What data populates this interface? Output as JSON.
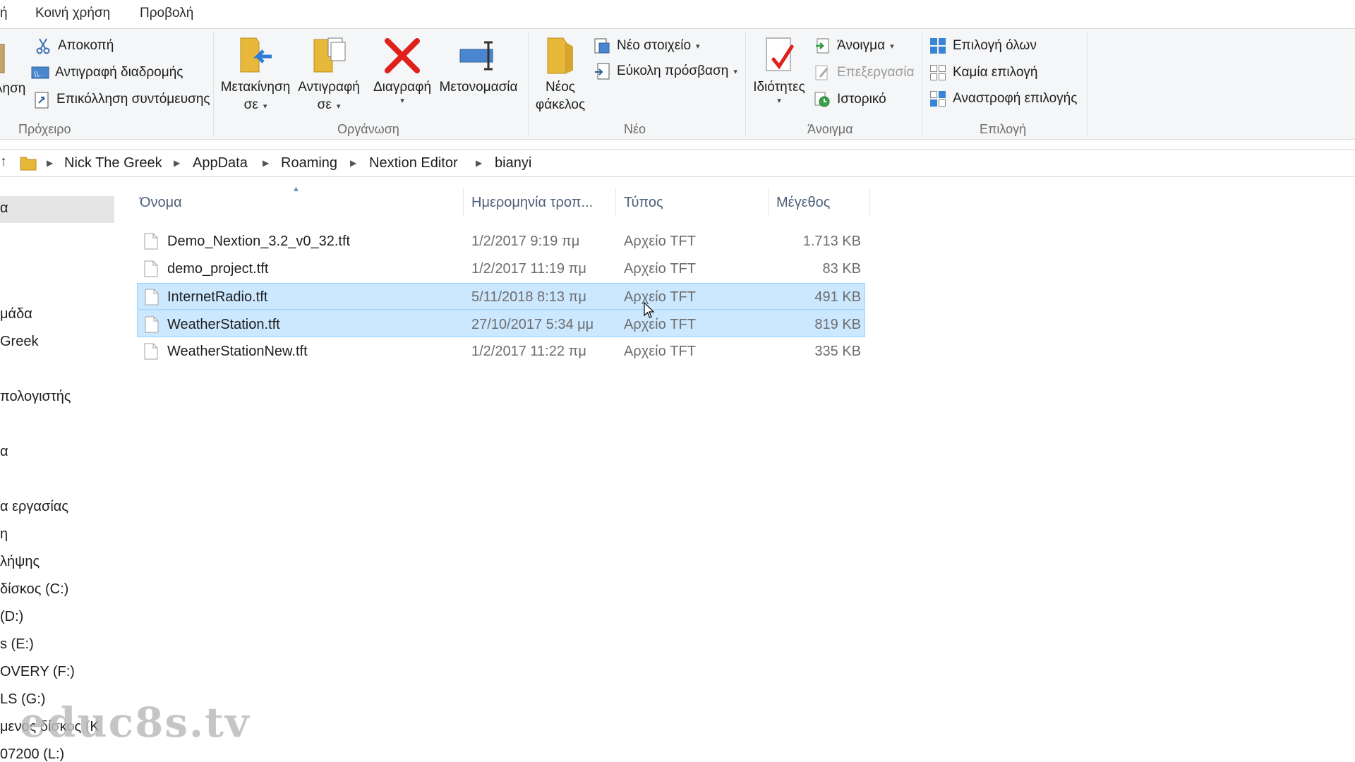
{
  "ribbon_tabs": [
    "ή",
    "Κοινή χρήση",
    "Προβολή"
  ],
  "clipboard": {
    "label": "Πρόχειρο",
    "paste_partial": "ληση",
    "cut": "Αποκοπή",
    "copy_path": "Αντιγραφή διαδρομής",
    "paste_shortcut": "Επικόλληση συντόμευσης"
  },
  "organize": {
    "label": "Οργάνωση",
    "move_to": [
      "Μετακίνηση",
      "σε"
    ],
    "copy_to": [
      "Αντιγραφή",
      "σε"
    ],
    "delete": "Διαγραφή",
    "rename": "Μετονομασία"
  },
  "new_group": {
    "label": "Νέο",
    "new_folder": [
      "Νέος",
      "φάκελος"
    ],
    "new_item": "Νέο στοιχείο",
    "easy_access": "Εύκολη πρόσβαση"
  },
  "open_group": {
    "label": "Άνοιγμα",
    "properties": "Ιδιότητες",
    "open": "Άνοιγμα",
    "edit": "Επεξεργασία",
    "history": "Ιστορικό"
  },
  "select_group": {
    "label": "Επιλογή",
    "select_all": "Επιλογή όλων",
    "select_none": "Καμία επιλογή",
    "invert": "Αναστροφή επιλογής"
  },
  "breadcrumb": [
    "Nick The Greek",
    "AppData",
    "Roaming",
    "Nextion Editor",
    "bianyi"
  ],
  "nav_items": [
    "α",
    "μάδα",
    " Greek",
    "πολογιστής",
    "α",
    "α εργασίας",
    "η",
    " λήψης",
    "δίσκος (C:)",
    " (D:)",
    "s  (E:)",
    "OVERY (F:)",
    "LS (G:)",
    "μενος δίσκος (K",
    "07200 (L:)"
  ],
  "columns": {
    "name": "Όνομα",
    "date": "Ημερομηνία τροπ...",
    "type": "Τύπος",
    "size": "Μέγεθος"
  },
  "files": [
    {
      "name": "Demo_Nextion_3.2_v0_32.tft",
      "date": "1/2/2017 9:19 πμ",
      "type": "Αρχείο TFT",
      "size": "1.713 KB",
      "selected": false
    },
    {
      "name": "demo_project.tft",
      "date": "1/2/2017 11:19 πμ",
      "type": "Αρχείο TFT",
      "size": "83 KB",
      "selected": false
    },
    {
      "name": "InternetRadio.tft",
      "date": "5/11/2018 8:13 πμ",
      "type": "Αρχείο TFT",
      "size": "491 KB",
      "selected": true
    },
    {
      "name": "WeatherStation.tft",
      "date": "27/10/2017 5:34 μμ",
      "type": "Αρχείο TFT",
      "size": "819 KB",
      "selected": true
    },
    {
      "name": "WeatherStationNew.tft",
      "date": "1/2/2017 11:22 πμ",
      "type": "Αρχείο TFT",
      "size": "335 KB",
      "selected": false
    }
  ],
  "watermark": "educ8s.tv",
  "colors": {
    "selection_bg": "#cce8ff",
    "selection_border": "#99d1ff",
    "delete_red": "#e0201b",
    "folder_yellow": "#e8b83a",
    "select_blue": "#3a84d8"
  }
}
